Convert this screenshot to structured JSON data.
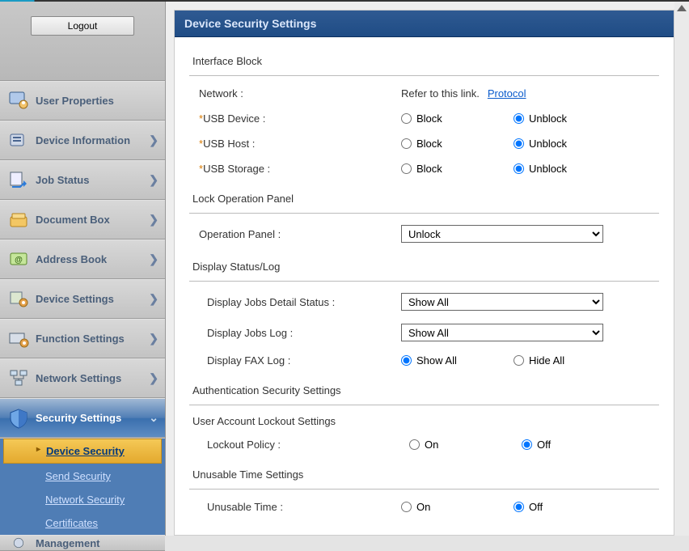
{
  "logout_label": "Logout",
  "sidebar": {
    "items": [
      {
        "label": "User Properties",
        "expandable": false
      },
      {
        "label": "Device Information",
        "expandable": true
      },
      {
        "label": "Job Status",
        "expandable": true
      },
      {
        "label": "Document Box",
        "expandable": true
      },
      {
        "label": "Address Book",
        "expandable": true
      },
      {
        "label": "Device Settings",
        "expandable": true
      },
      {
        "label": "Function Settings",
        "expandable": true
      },
      {
        "label": "Network Settings",
        "expandable": true
      },
      {
        "label": "Security Settings",
        "expandable": true,
        "active": true
      }
    ],
    "subitems": [
      {
        "label": "Device Security",
        "active": true
      },
      {
        "label": "Send Security"
      },
      {
        "label": "Network Security"
      },
      {
        "label": "Certificates"
      }
    ],
    "partial_next": "Management"
  },
  "page": {
    "title": "Device Security Settings",
    "sections": {
      "interface_block": {
        "title": "Interface Block",
        "network_label": "Network :",
        "refer_text": "Refer to this link.",
        "protocol_link": "Protocol",
        "rows": [
          {
            "label": "USB Device :",
            "required": true,
            "opt1": "Block",
            "opt2": "Unblock",
            "selected": "Unblock"
          },
          {
            "label": "USB Host :",
            "required": true,
            "opt1": "Block",
            "opt2": "Unblock",
            "selected": "Unblock"
          },
          {
            "label": "USB Storage :",
            "required": true,
            "opt1": "Block",
            "opt2": "Unblock",
            "selected": "Unblock"
          }
        ]
      },
      "lock_panel": {
        "title": "Lock Operation Panel",
        "label": "Operation Panel :",
        "value": "Unlock"
      },
      "display_status": {
        "title": "Display Status/Log",
        "jobs_detail_label": "Display Jobs Detail Status :",
        "jobs_detail_value": "Show All",
        "jobs_log_label": "Display Jobs Log :",
        "jobs_log_value": "Show All",
        "fax_log_label": "Display FAX Log :",
        "fax_opt1": "Show All",
        "fax_opt2": "Hide All",
        "fax_selected": "Show All"
      },
      "auth_security": {
        "title": "Authentication Security Settings",
        "lockout_title": "User Account Lockout Settings",
        "lockout_label": "Lockout Policy :",
        "lockout_opt1": "On",
        "lockout_opt2": "Off",
        "lockout_selected": "Off"
      },
      "unusable_time": {
        "title": "Unusable Time Settings",
        "label": "Unusable Time :",
        "opt1": "On",
        "opt2": "Off",
        "selected": "Off"
      }
    }
  }
}
